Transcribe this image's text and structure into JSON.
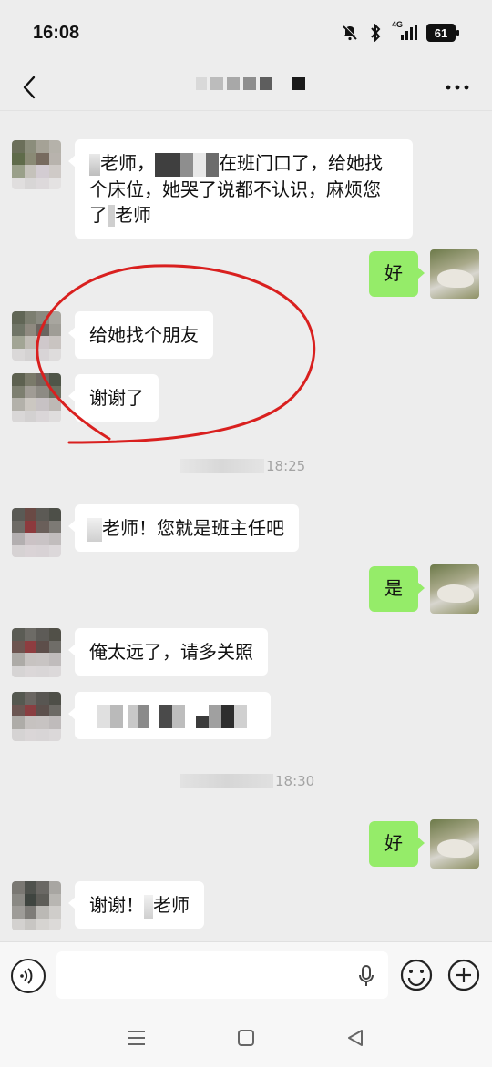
{
  "status_bar": {
    "time": "16:08",
    "network": "4G",
    "battery": "61"
  },
  "nav": {
    "back_icon": "chevron-left-icon",
    "more_icon": "more-dots-icon"
  },
  "messages": [
    {
      "side": "left",
      "parts": [
        "",
        "老师，",
        "在班门口了，给她找个床位，她哭了说都不认识，麻烦您了",
        "老师"
      ]
    },
    {
      "side": "right",
      "text": "好"
    },
    {
      "side": "left",
      "text": "给她找个朋友"
    },
    {
      "side": "left",
      "text": "谢谢了"
    },
    {
      "side": "left",
      "text": "老师！您就是班主任吧"
    },
    {
      "side": "right",
      "text": "是"
    },
    {
      "side": "left",
      "text": "俺太远了，请多关照"
    },
    {
      "side": "right",
      "text": "好"
    },
    {
      "side": "left",
      "text": "谢谢！",
      "tail": "老师"
    }
  ],
  "timestamps": [
    "18:25",
    "18:30"
  ],
  "input": {
    "placeholder": "",
    "value": ""
  },
  "colors": {
    "background": "#ededed",
    "bubble_mine": "#95ec69",
    "bubble_other": "#ffffff",
    "annotation": "#d9201f"
  }
}
